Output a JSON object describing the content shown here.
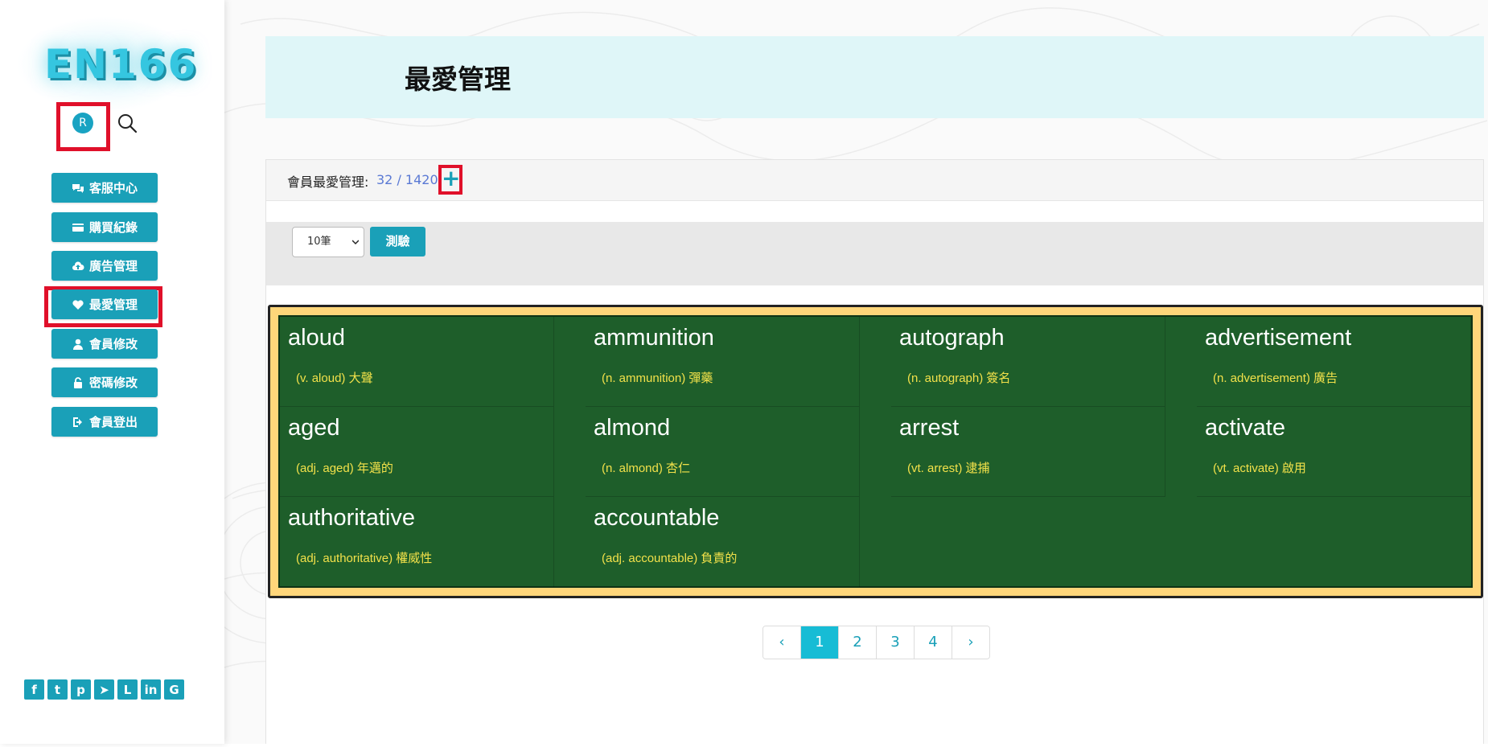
{
  "logo": {
    "text": "EN166"
  },
  "user": {
    "avatar_letter": "R"
  },
  "nav": {
    "items": [
      {
        "label": "客服中心",
        "icon": "comments-icon"
      },
      {
        "label": "購買紀錄",
        "icon": "card-icon"
      },
      {
        "label": "廣告管理",
        "icon": "cloud-upload-icon"
      },
      {
        "label": "最愛管理",
        "icon": "heart-icon"
      },
      {
        "label": "會員修改",
        "icon": "user-icon"
      },
      {
        "label": "密碼修改",
        "icon": "unlock-icon"
      },
      {
        "label": "會員登出",
        "icon": "sign-out-icon"
      }
    ]
  },
  "socials": [
    {
      "name": "facebook-icon",
      "glyph": "f"
    },
    {
      "name": "twitter-icon",
      "glyph": "t"
    },
    {
      "name": "pinterest-icon",
      "glyph": "p"
    },
    {
      "name": "telegram-icon",
      "glyph": "➤"
    },
    {
      "name": "line-icon",
      "glyph": "L"
    },
    {
      "name": "linkedin-icon",
      "glyph": "in"
    },
    {
      "name": "google-icon",
      "glyph": "G"
    }
  ],
  "page": {
    "title": "最愛管理"
  },
  "panel": {
    "label": "會員最愛管理:",
    "count": "32 / 1420",
    "add_symbol": "+"
  },
  "toolbar": {
    "select_value": "10筆",
    "test_label": "測驗"
  },
  "cards": [
    {
      "word": "aloud",
      "def": "(v. aloud) 大聲"
    },
    {
      "word": "ammunition",
      "def": "(n. ammunition) 彈藥"
    },
    {
      "word": "autograph",
      "def": "(n. autograph) 簽名"
    },
    {
      "word": "advertisement",
      "def": "(n. advertisement) 廣告"
    },
    {
      "word": "aged",
      "def": "(adj. aged) 年邁的"
    },
    {
      "word": "almond",
      "def": "(n. almond) 杏仁"
    },
    {
      "word": "arrest",
      "def": "(vt. arrest) 逮捕"
    },
    {
      "word": "activate",
      "def": "(vt. activate) 啟用"
    },
    {
      "word": "authoritative",
      "def": "(adj. authoritative) 權威性"
    },
    {
      "word": "accountable",
      "def": "(adj. accountable) 負責的"
    }
  ],
  "pagination": {
    "prev": "‹",
    "pages": [
      "1",
      "2",
      "3",
      "4"
    ],
    "active": "1",
    "next": "›"
  },
  "colors": {
    "accent": "#1aa0b8",
    "highlight": "#e0102a",
    "board_border": "#ffd67a",
    "board_bg": "#1e5e2a",
    "definition": "#f2e14a"
  }
}
